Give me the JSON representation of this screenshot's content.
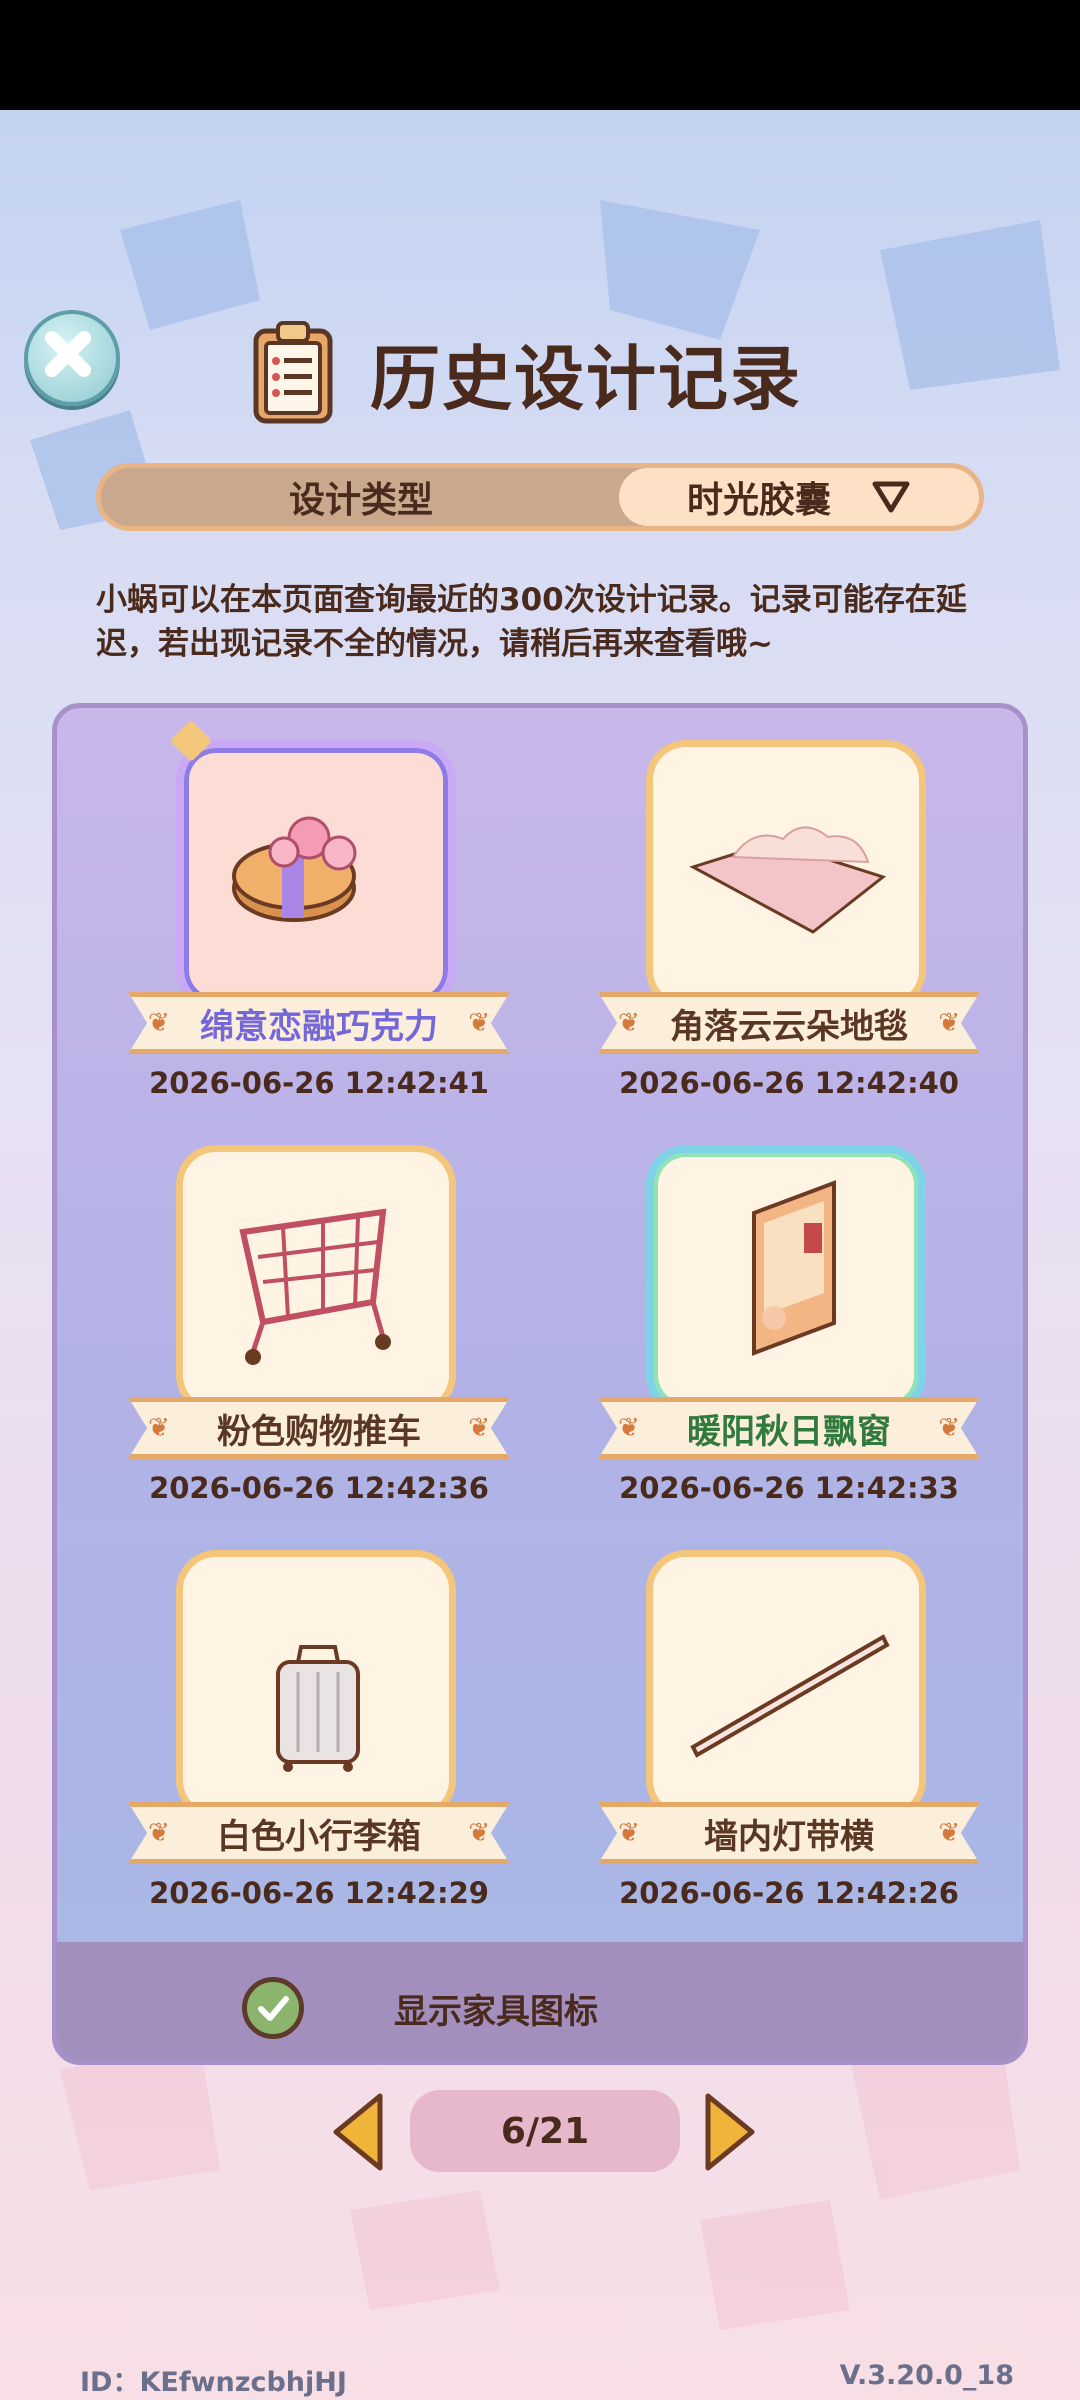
{
  "header": {
    "title": "历史设计记录"
  },
  "tabs": {
    "left_label": "设计类型",
    "right_label": "时光胶囊"
  },
  "description": "小蜗可以在本页面查询最近的300次设计记录。记录可能存在延迟，若出现记录不全的情况，请稍后再来查看哦~",
  "records": [
    {
      "name": "绵意恋融巧克力",
      "time": "2026-06-26 12:42:41"
    },
    {
      "name": "角落云云朵地毯",
      "time": "2026-06-26 12:42:40"
    },
    {
      "name": "粉色购物推车",
      "time": "2026-06-26 12:42:36"
    },
    {
      "name": "暖阳秋日飘窗",
      "time": "2026-06-26 12:42:33"
    },
    {
      "name": "白色小行李箱",
      "time": "2026-06-26 12:42:29"
    },
    {
      "name": "墙内灯带横",
      "time": "2026-06-26 12:42:26"
    }
  ],
  "toggle": {
    "label": "显示家具图标",
    "checked": true
  },
  "pagination": {
    "page_text": "6/21"
  },
  "footer": {
    "id": "ID：KEfwnzcbhjHJ",
    "version": "V.3.20.0_18"
  },
  "colors": {
    "text_brown": "#4a2a1c",
    "card_border": "#f3c67b",
    "panel": "#b2b2e6"
  }
}
